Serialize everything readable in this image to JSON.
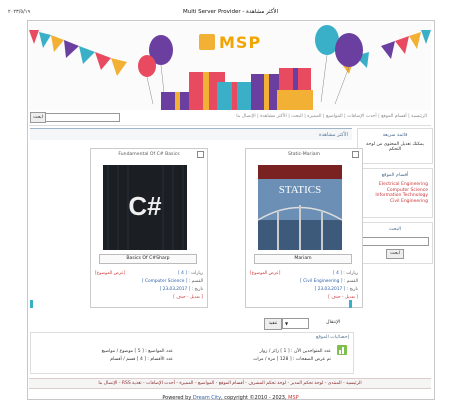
{
  "header": {
    "date": "٢٠٢٣/٥/١٩",
    "title": "Multi Server Provider - الأكثر مشاهدة",
    "logo_text": "MSP"
  },
  "nav": {
    "links": "الرئيسية | أقسام الموقع | أحدث الإضافات | المواضيع | المميزة | البحث | الأكثر مشاهدة | الإتصال بنا",
    "search_button": "ابحث",
    "search_value": ""
  },
  "sidebar": {
    "box1_title": "قائمة سريعة",
    "box1_text": "يمكنك تعديل المحتوى من لوحة التحكم",
    "box2_title": "أقسام الموقع",
    "categories": [
      "Electrical Engineering",
      "Computer Science",
      "Information Technology",
      "Civil Engineering"
    ],
    "box3_title": "البحث",
    "search_button": "ابحث"
  },
  "main": {
    "heading": "الأكثر مشاهدة",
    "cards": [
      {
        "title": "Static-Mariam",
        "book_label": "Mariam",
        "visits_label": "زيارات :",
        "visits": "[ 4 ]",
        "view": "[عرض الموضوع]",
        "category_label": "القسم :",
        "category": "[ Civil Engineering ]",
        "date_label": "تاريخ :",
        "date": "[ 2017ـ03ـ23 ]",
        "actions": "[ تعديل - حذف ]",
        "cover_word": "STATICS"
      },
      {
        "title": "Fundamental Of C# Basics",
        "book_label": "Basics Of C#Sharp",
        "visits_label": "زيارات :",
        "visits": "[ 4 ]",
        "view": "[عرض الموضوع]",
        "category_label": "القسم :",
        "category": "[ Computer Science ]",
        "date_label": "تاريخ :",
        "date": "[ 2017ـ03ـ23 ]",
        "actions": "[ تعديل - حذف ]",
        "cover_word": "C#"
      }
    ],
    "jump_label": "الإنتقال",
    "jump_value": "",
    "go_button": "تنفيذ"
  },
  "stats": {
    "title": "إحصائيات الموقع",
    "r1c1": "عدد المتواجدين الآن : [ 1 ] زائر / زوار",
    "r1c2": "عدد المواضيع : [ 5 ] موضوع / مواضيع",
    "r2c1": "تم عرض الصفحات : [ 128 ] مرة / مرات",
    "r2c2": "عدد الأقسام : [ 4 ] قسم / أقسام"
  },
  "footer": {
    "nav": "الرئيسية - المنتدى - لوحة تحكم المدير - لوحة تحكم المشرف - أقسام الموقع - المواضيع - المميزة - أحدث الإضافات - تغذية RSS - الإتصال بنا",
    "powered_prefix": "Powered by",
    "powered_brand": "Dream City",
    "powered_mid": ", copyright ©2010 - 2023,",
    "powered_msp": "MSP"
  },
  "colors": {
    "accent": "#2b5fa8",
    "brand_red": "#cc3333",
    "heading": "#5a7a95"
  }
}
